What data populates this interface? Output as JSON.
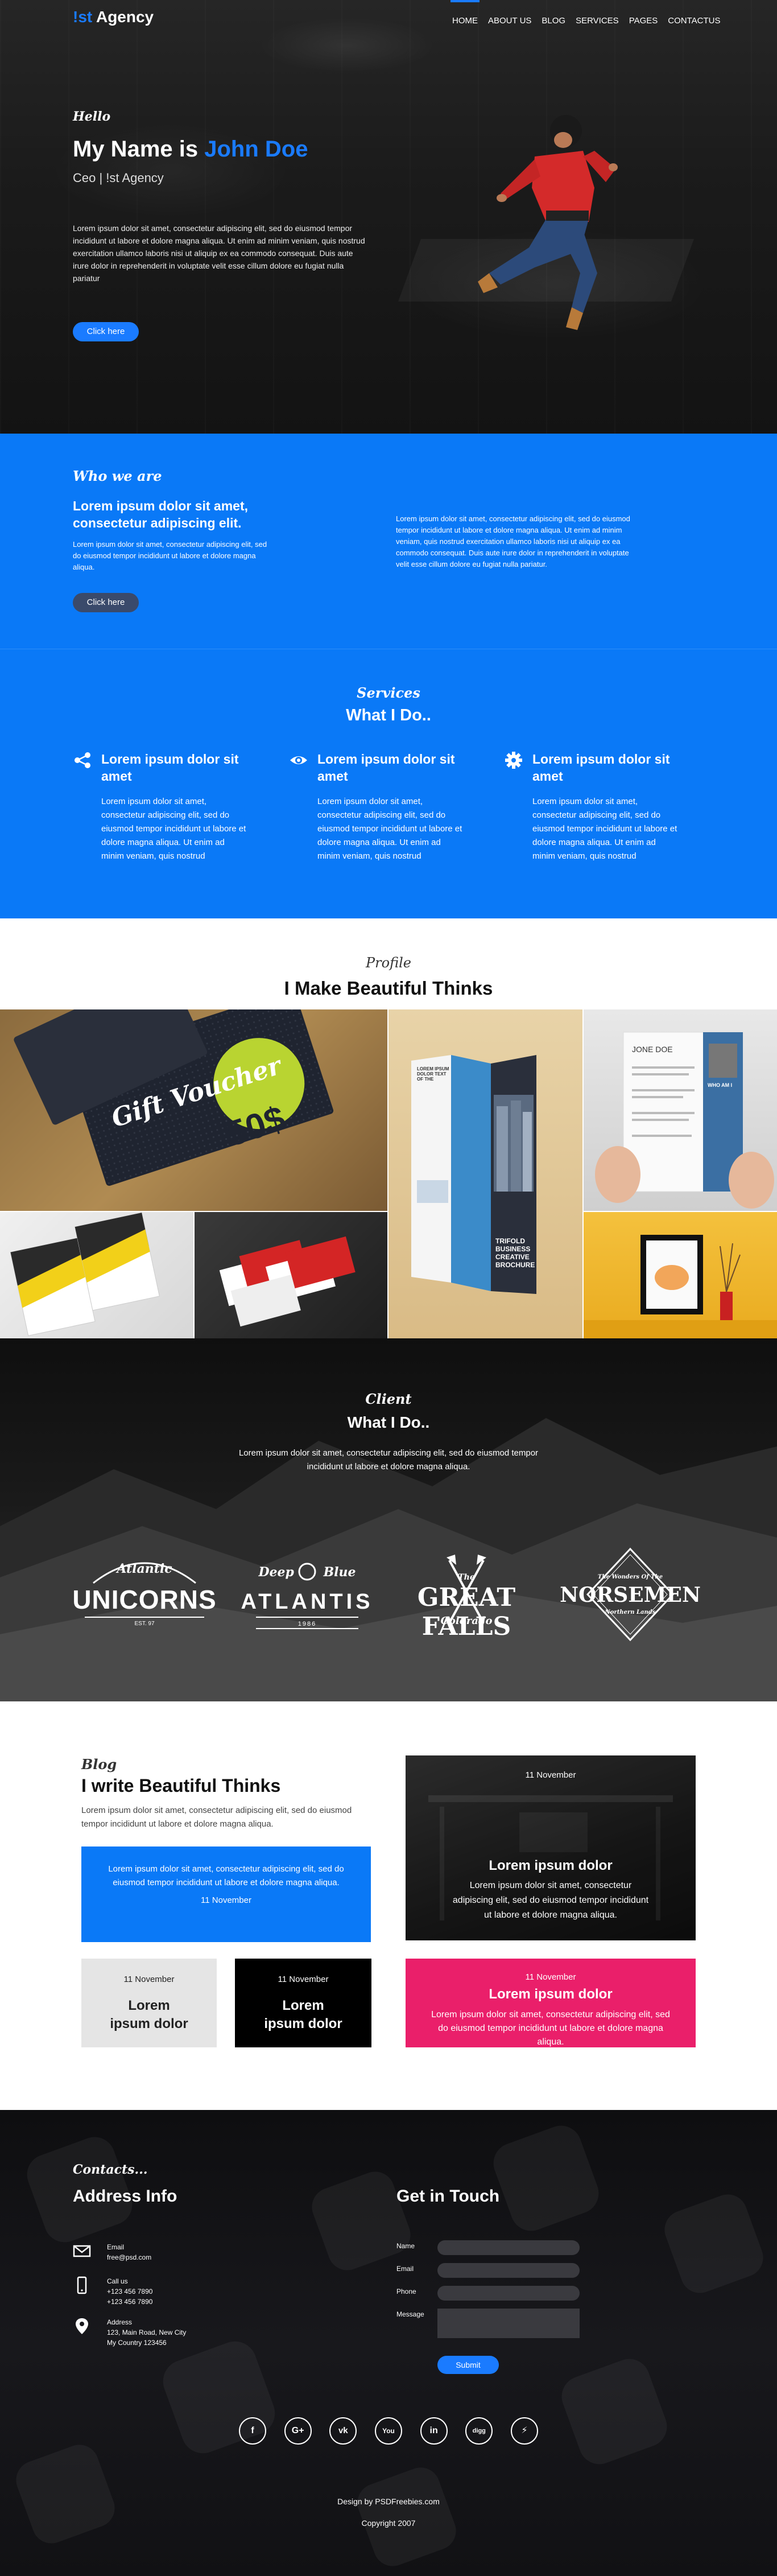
{
  "nav": {
    "logo_accent": "!st",
    "logo_text": " Agency",
    "items": [
      "HOME",
      "ABOUT US",
      "BLOG",
      "SERVICES",
      "PAGES",
      "CONTACTUS"
    ]
  },
  "hero": {
    "hello": "Hello",
    "title_prefix": "My Name is ",
    "title_name": "John Doe",
    "subtitle": "Ceo | !st Agency",
    "text": "Lorem ipsum dolor sit amet, consectetur adipiscing elit, sed do eiusmod tempor incididunt ut labore et dolore magna aliqua. Ut enim ad minim veniam, quis nostrud exercitation ullamco laboris nisi ut aliquip ex ea commodo consequat. Duis aute irure dolor in reprehenderit in voluptate velit esse cillum dolore eu fugiat nulla pariatur",
    "button": "Click here"
  },
  "who": {
    "label": "Who we are",
    "title": "Lorem ipsum dolor sit amet, consectetur adipiscing elit.",
    "text_left": "Lorem ipsum dolor sit amet, consectetur adipiscing elit, sed do eiusmod tempor incididunt ut labore et dolore magna aliqua.",
    "text_right": "Lorem ipsum dolor sit amet, consectetur adipiscing elit, sed do eiusmod tempor incididunt ut labore et dolore magna aliqua. Ut enim ad minim veniam, quis nostrud exercitation ullamco laboris nisi ut aliquip ex ea commodo consequat. Duis aute irure dolor in reprehenderit in voluptate velit esse cillum dolore eu fugiat nulla pariatur.",
    "button": "Click here"
  },
  "services": {
    "label": "Services",
    "title": "What I Do..",
    "items": [
      {
        "icon": "share-icon",
        "head": "Lorem ipsum dolor sit amet",
        "text": "Lorem ipsum dolor sit amet, consectetur adipiscing elit, sed do eiusmod tempor incididunt ut labore et dolore magna aliqua. Ut enim ad minim veniam, quis nostrud"
      },
      {
        "icon": "eye-icon",
        "head": "Lorem ipsum dolor sit amet",
        "text": "Lorem ipsum dolor sit amet, consectetur adipiscing elit, sed do eiusmod tempor incididunt ut labore et dolore magna aliqua. Ut enim ad minim veniam, quis nostrud"
      },
      {
        "icon": "gear-icon",
        "head": "Lorem ipsum dolor sit amet",
        "text": "Lorem ipsum dolor sit amet, consectetur adipiscing elit, sed do eiusmod tempor incididunt ut labore et dolore magna aliqua. Ut enim ad minim veniam, quis nostrud"
      }
    ]
  },
  "profile": {
    "label": "Profile",
    "title": "I Make Beautiful Thinks",
    "voucher_script": "Gift Voucher",
    "voucher_amount": "50$",
    "brochure_title": "TRIFOLD BUSINESS CREATIVE BROCHURE",
    "brochure_head": "LOREM IPSUM DOLOR TEXT OF THE",
    "resume_name": "JONE DOE",
    "resume_who": "WHO AM I"
  },
  "client": {
    "label": "Client",
    "title": "What I Do..",
    "text": "Lorem ipsum dolor sit amet, consectetur adipiscing elit, sed do eiusmod tempor incididunt ut labore et dolore magna aliqua.",
    "logos": [
      {
        "top": "Atlantic",
        "main": "UNICORNS",
        "bottom": "EST. 97"
      },
      {
        "top": "Deep Blue",
        "main": "ATLANTIS",
        "bottom": "1986"
      },
      {
        "top": "The",
        "main": "GREAT FALLS",
        "bottom": "Colorado"
      },
      {
        "top": "The Wonders Of The",
        "main": "NORSEMEN",
        "bottom": "Northern Lands"
      }
    ]
  },
  "blog": {
    "label": "Blog",
    "title": "I write Beautiful Thinks",
    "text": "Lorem ipsum dolor sit amet, consectetur adipiscing elit, sed do eiusmod tempor incididunt ut labore et dolore magna aliqua.",
    "card_blue": {
      "text": "Lorem ipsum dolor sit amet, consectetur adipiscing elit, sed do eiusmod tempor incididunt ut labore et dolore magna aliqua.",
      "date": "11 November"
    },
    "card_grey": {
      "date": "11 November",
      "head": "Lorem ipsum dolor"
    },
    "card_black": {
      "date": "11 November",
      "head": "Lorem ipsum dolor"
    },
    "card_photo": {
      "date": "11 November",
      "head": "Lorem ipsum dolor",
      "text": "Lorem ipsum dolor sit amet, consectetur adipiscing elit, sed do eiusmod tempor incididunt ut labore et dolore magna aliqua."
    },
    "card_pink": {
      "date": "11 November",
      "head": "Lorem ipsum dolor",
      "text": "Lorem ipsum dolor sit amet, consectetur adipiscing elit, sed do eiusmod tempor incididunt ut labore et dolore magna aliqua."
    }
  },
  "contact": {
    "label": "Contacts...",
    "address_title": "Address Info",
    "touch_title": "Get in Touch",
    "email_label": "Email",
    "email_value": "free@psd.com",
    "call_label": "Call us",
    "phone_1": "+123 456 7890",
    "phone_2": "+123 456 7890",
    "address_label": "Address",
    "address_1": "123, Main Road, New City",
    "address_2": "My Country 123456",
    "form_name": "Name",
    "form_email": "Email",
    "form_phone": "Phone",
    "form_message": "Message",
    "submit": "Submit",
    "social": [
      {
        "icon": "facebook-icon",
        "glyph": "f"
      },
      {
        "icon": "google-plus-icon",
        "glyph": "G+"
      },
      {
        "icon": "vk-icon",
        "glyph": "vk"
      },
      {
        "icon": "youtube-icon",
        "glyph": "You"
      },
      {
        "icon": "linkedin-icon",
        "glyph": "in"
      },
      {
        "icon": "digg-icon",
        "glyph": "digg"
      },
      {
        "icon": "lightning-icon",
        "glyph": "⚡"
      }
    ],
    "design_credit": "Design by PSDFreebies.com",
    "copyright": "Copyright 2007"
  },
  "colors": {
    "accent": "#1a7bff",
    "section_blue": "#0a79f7",
    "pink": "#ea1f6a"
  }
}
